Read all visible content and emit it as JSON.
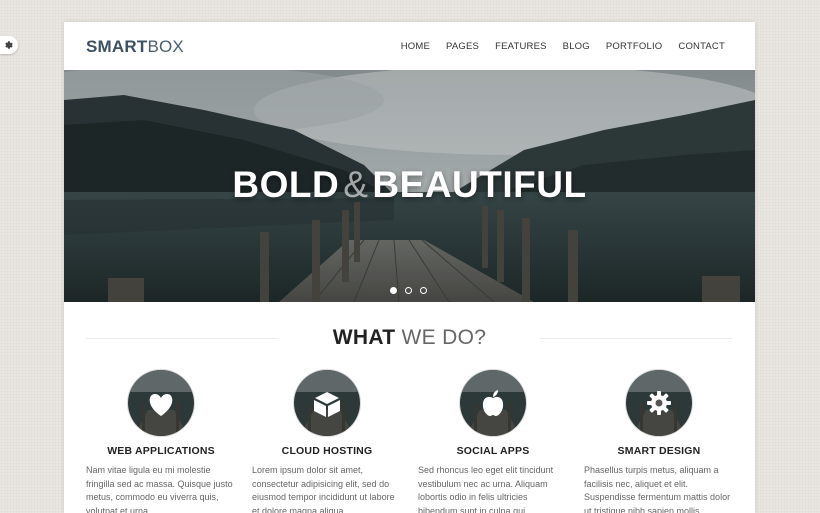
{
  "logo": {
    "bold": "SMART",
    "light": "BOX"
  },
  "nav": [
    "HOME",
    "PAGES",
    "FEATURES",
    "BLOG",
    "PORTFOLIO",
    "CONTACT"
  ],
  "hero": {
    "word1": "BOLD",
    "amp": "&",
    "word2": "BEAUTIFUL",
    "slides": 3,
    "active_slide": 1
  },
  "section": {
    "bold": "WHAT",
    "light": "WE DO?"
  },
  "features": [
    {
      "title": "WEB APPLICATIONS",
      "icon": "heart-icon",
      "text": "Nam vitae ligula eu mi molestie fringilla sed ac massa. Quisque justo metus, commodo eu viverra quis, volutpat et urna."
    },
    {
      "title": "CLOUD HOSTING",
      "icon": "cube-icon",
      "text": "Lorem ipsum dolor sit amet, consectetur adipisicing elit, sed do eiusmod tempor incididunt ut labore et dolore magna aliqua."
    },
    {
      "title": "SOCIAL APPS",
      "icon": "apple-icon",
      "text": "Sed rhoncus leo eget elit tincidunt vestibulum nec ac urna. Aliquam lobortis odio in felis ultricies bibendum sunt in culpa qui."
    },
    {
      "title": "SMART DESIGN",
      "icon": "gear-icon",
      "text": "Phasellus turpis metus, aliquam a facilisis nec, aliquet et elit. Suspendisse fermentum mattis dolor ut tristique nibh sapien mollis."
    }
  ]
}
